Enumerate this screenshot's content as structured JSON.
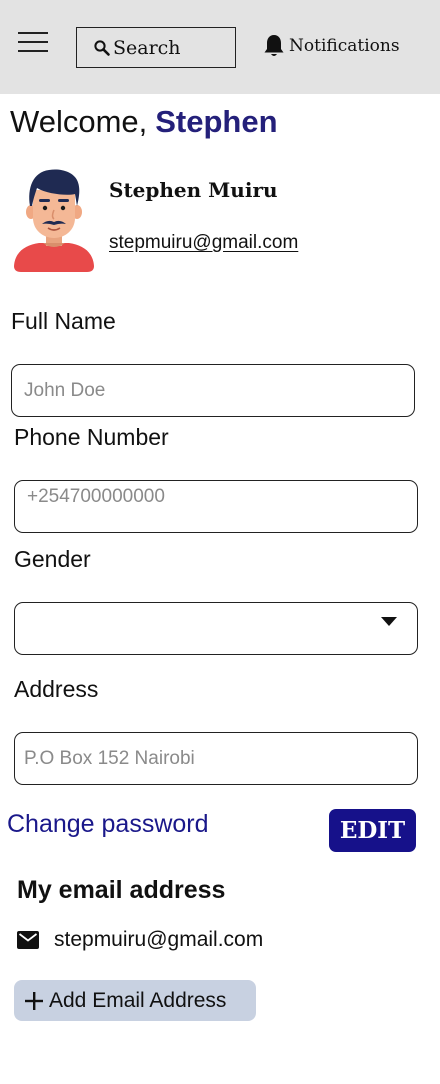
{
  "header": {
    "search_label": "Search",
    "notifications_label": "Notifications",
    "icons": [
      "menu-icon",
      "search-icon",
      "bell-icon"
    ]
  },
  "welcome": {
    "greeting": "Welcome,",
    "username": "Stephen",
    "username_color": "#24207a"
  },
  "profile": {
    "name": "Stephen Muiru",
    "email": "stepmuiru@gmail.com"
  },
  "form": {
    "full_name": {
      "label": "Full Name",
      "placeholder": "John Doe",
      "value": ""
    },
    "phone": {
      "label": "Phone Number",
      "placeholder": "+254700000000",
      "value": ""
    },
    "gender": {
      "label": "Gender",
      "value": ""
    },
    "address": {
      "label": "Address",
      "placeholder": "P.O Box 152 Nairobi",
      "value": ""
    }
  },
  "actions": {
    "change_password_label": "Change password",
    "edit_label": "EDIT",
    "accent_color": "#16118a"
  },
  "emails_section": {
    "heading": "My email address",
    "emails": [
      "stepmuiru@gmail.com"
    ],
    "add_label": "Add Email Address"
  }
}
